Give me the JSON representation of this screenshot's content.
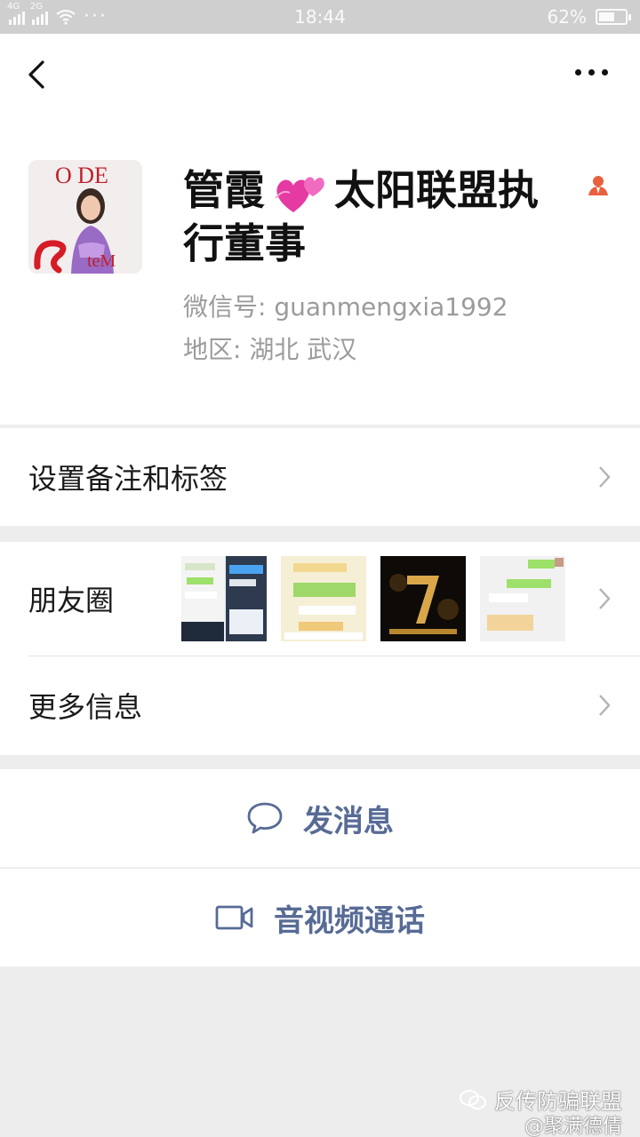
{
  "status_bar": {
    "network_1": "4G",
    "network_2": "2G",
    "more_dots": "···",
    "time": "18:44",
    "battery": "62%",
    "battery_level": 0.62
  },
  "profile": {
    "name_line1": "管霞",
    "name_line2": "太阳联盟执",
    "name_line3": "行董事",
    "wechat_id": "微信号: guanmengxia1992",
    "region": "地区: 湖北  武汉",
    "avatar_logo_top": "O DE",
    "avatar_logo_bottom": "teM"
  },
  "rows": {
    "remark": "设置备注和标签",
    "moments": "朋友圈",
    "more_info": "更多信息"
  },
  "actions": {
    "message": "发消息",
    "call": "音视频通话"
  },
  "watermark": {
    "line1": "反传防骗联盟",
    "line2": "@聚满德倩"
  },
  "colors": {
    "accent": "#576b95",
    "background": "#ededed",
    "secondary_text": "#9b9b9b"
  }
}
